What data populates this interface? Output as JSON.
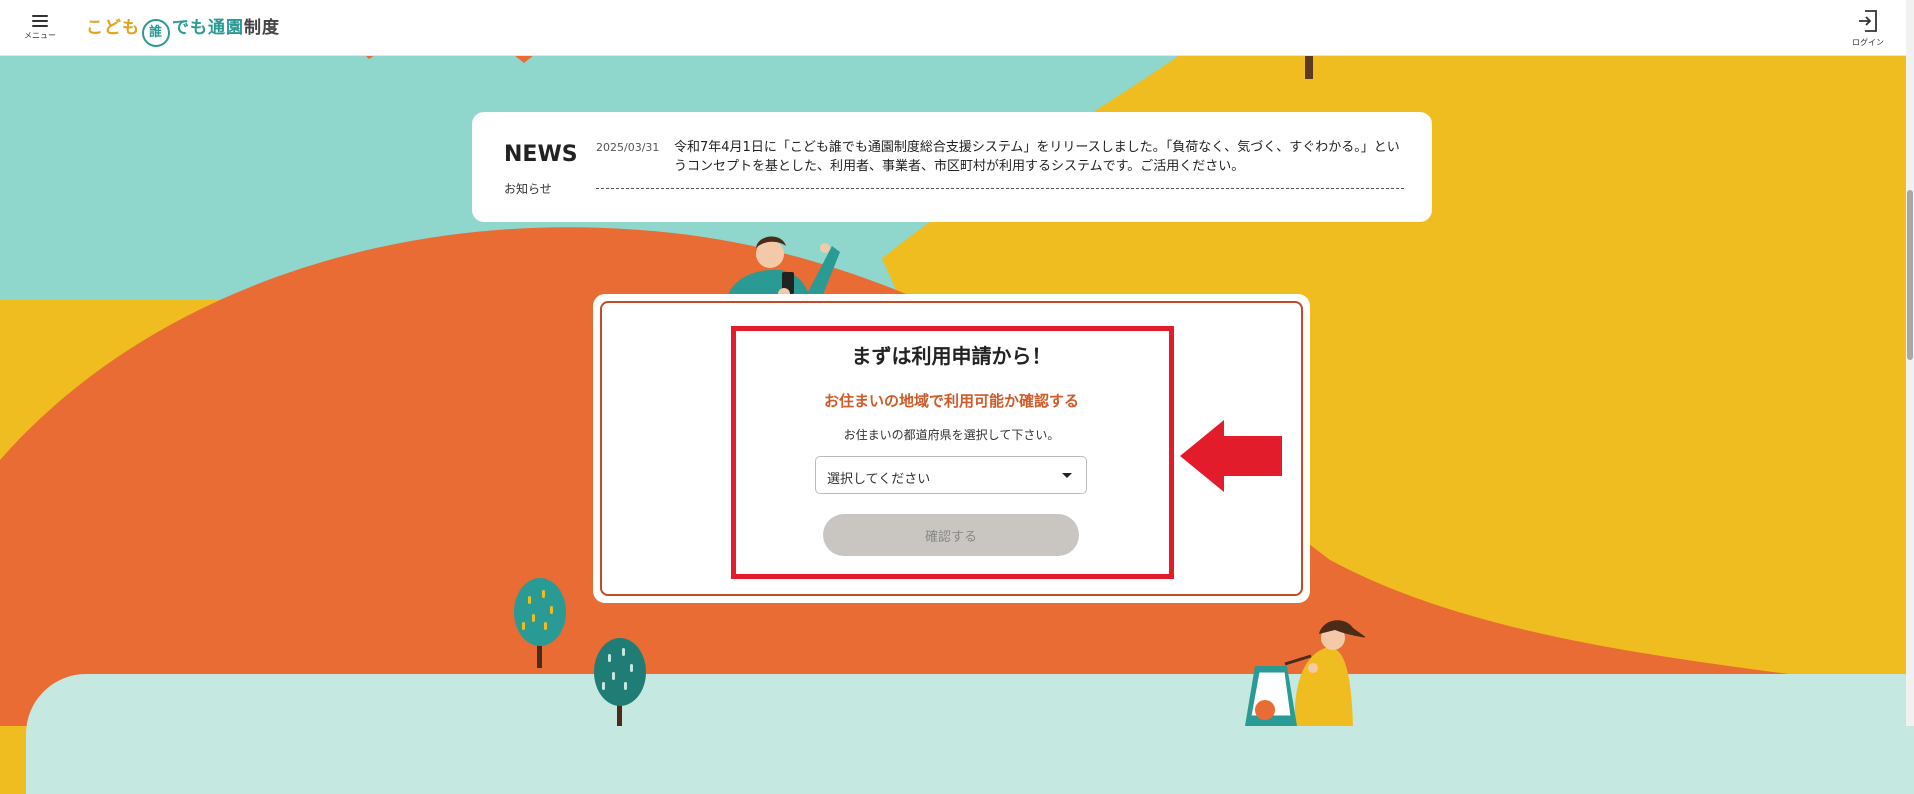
{
  "header": {
    "menu_label": "メニュー",
    "logo_part1": "こども",
    "logo_circle": "誰",
    "logo_part2": "でも通園",
    "logo_part3": "制度",
    "login_label": "ログイン"
  },
  "news": {
    "title": "NEWS",
    "subtitle": "お知らせ",
    "items": [
      {
        "date": "2025/03/31",
        "text": "令和7年4月1日に「こども誰でも通園制度総合支援システム」をリリースしました。「負荷なく、気づく、すぐわかる。」というコンセプトを基とした、利用者、事業者、市区町村が利用するシステムです。ご活用ください。"
      }
    ]
  },
  "application": {
    "title": "まずは利用申請から！",
    "subtitle": "お住まいの地域で利用可能か確認する",
    "note": "お住まいの都道府県を選択して下さい。",
    "select_placeholder": "選択してください",
    "confirm_label": "確認する"
  },
  "colors": {
    "teal": "#8fd6cc",
    "orange": "#e86c34",
    "yellow": "#efbd20",
    "highlight_red": "#e31c2c",
    "logo_teal": "#2a9a94",
    "logo_yellow": "#e2a21b"
  }
}
